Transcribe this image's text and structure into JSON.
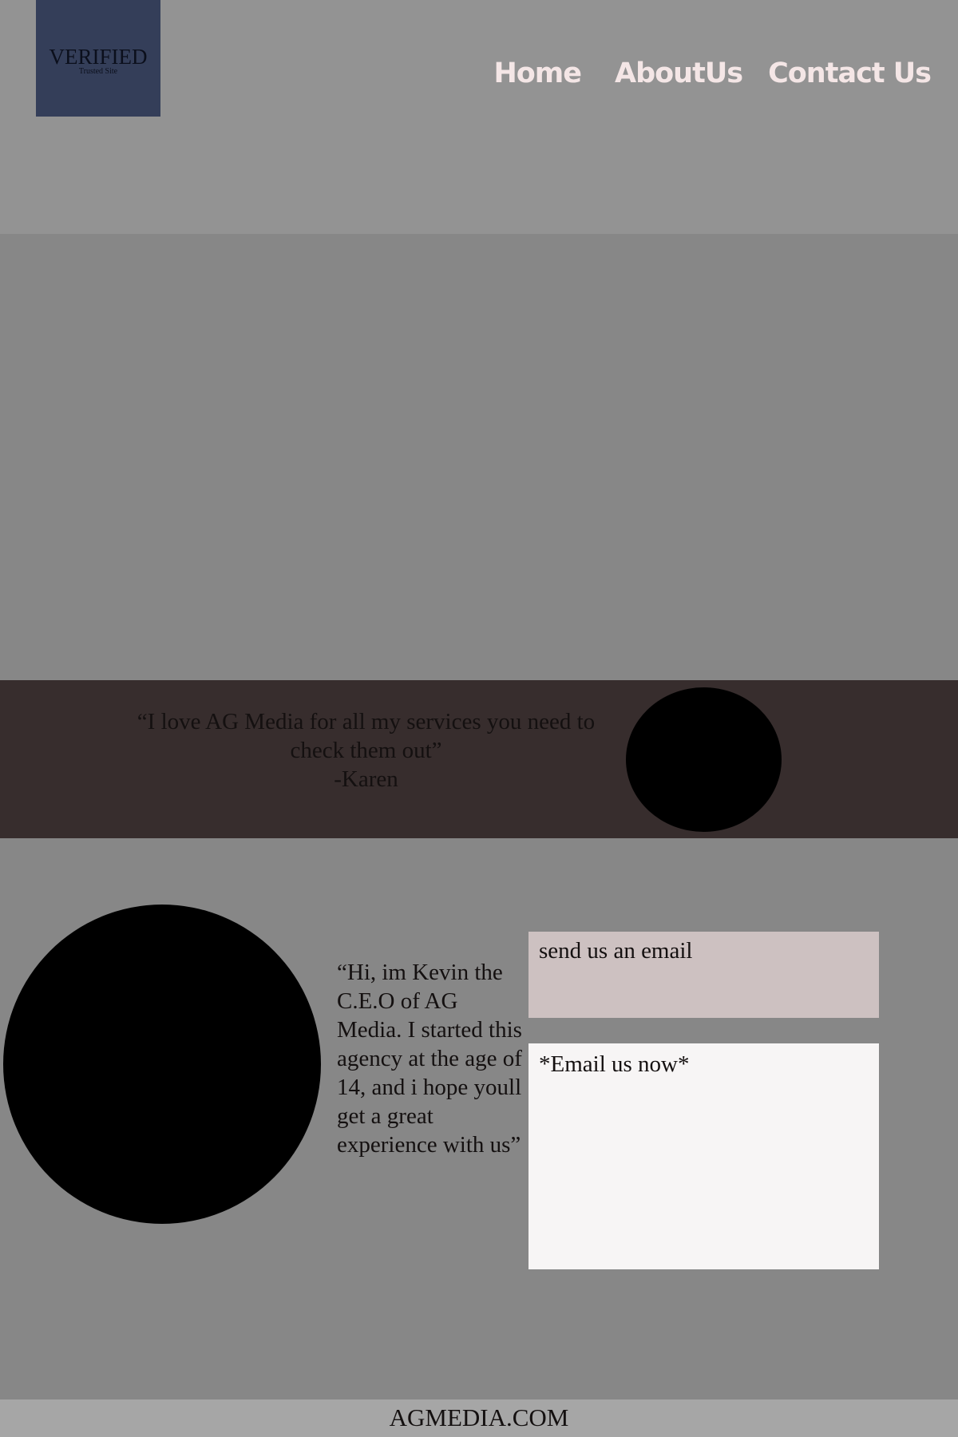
{
  "header": {
    "badge": {
      "title": "VERIFIED",
      "subtitle": "Trusted Site"
    },
    "nav": {
      "home": "Home",
      "about": "AboutUs",
      "contact": "Contact Us"
    }
  },
  "testimonial": {
    "quote": "“I love AG Media for all my services you need to check them out”",
    "author": "-Karen"
  },
  "ceo": {
    "message": "“Hi, im Kevin the C.E.O of AG Media. I started this agency at the age of 14, and i hope youll get a great experience with us”"
  },
  "contact": {
    "label": "send us an email",
    "placeholder": "*Email us now*"
  },
  "footer": {
    "text": "AGMEDIA.COM"
  }
}
